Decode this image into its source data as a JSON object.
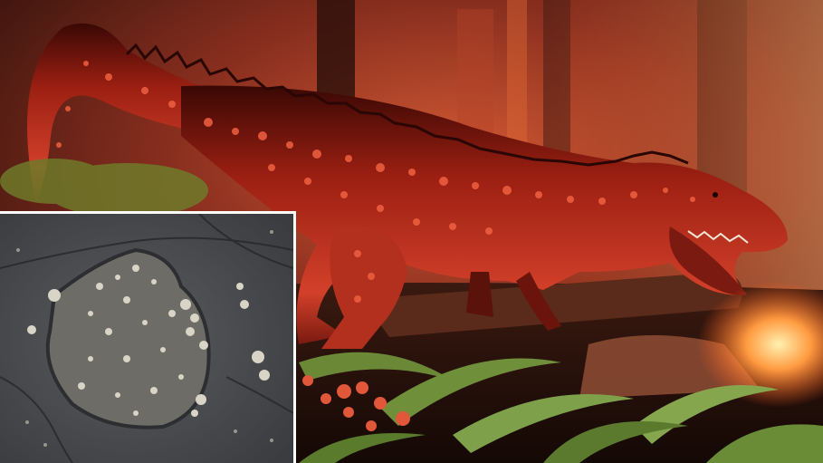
{
  "image": {
    "main_scene": {
      "subject": "dinosaur-illustration",
      "palette": {
        "sky_glow": "#c24a2a",
        "smoke": "#7a3324",
        "dinosaur_base": "#8a1a10",
        "dinosaur_highlight": "#e0452a",
        "dinosaur_spots": "#f05a3a",
        "fern": "#6f8f3a",
        "flowers": "#e0573a",
        "fire": "#ff9a4a"
      }
    },
    "inset_photo": {
      "subject": "footprint-fossil-in-rock",
      "palette": {
        "rock": "#4d4f52",
        "rock_dark": "#2c2e31",
        "barnacles": "#d8d4c6"
      }
    }
  }
}
